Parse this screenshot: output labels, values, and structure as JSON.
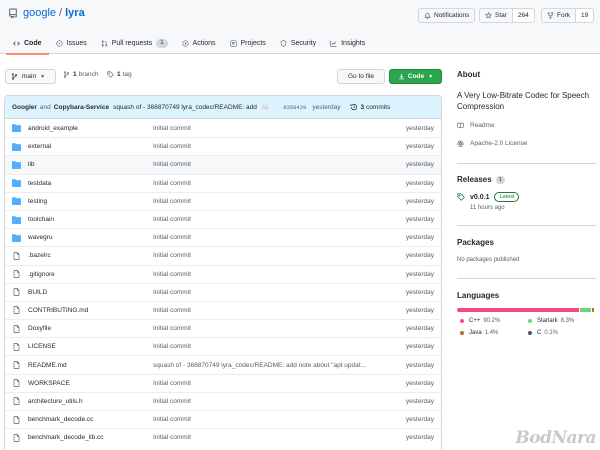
{
  "repo": {
    "owner": "google",
    "separator": "/",
    "name": "lyra"
  },
  "header_buttons": {
    "notifications": "Notifications",
    "star": "Star",
    "star_count": "264",
    "fork": "Fork",
    "fork_count": "19"
  },
  "tabs": [
    {
      "label": "Code",
      "icon": "code-icon"
    },
    {
      "label": "Issues",
      "icon": "issue-icon"
    },
    {
      "label": "Pull requests",
      "icon": "pull-request-icon",
      "badge": "1"
    },
    {
      "label": "Actions",
      "icon": "play-icon"
    },
    {
      "label": "Projects",
      "icon": "project-icon"
    },
    {
      "label": "Security",
      "icon": "shield-icon"
    },
    {
      "label": "Insights",
      "icon": "graph-icon"
    }
  ],
  "branch_bar": {
    "branch": "main",
    "branches_count": "1",
    "branches_label": "branch",
    "tags_count": "1",
    "tags_label": "tag",
    "goto_file": "Go to file",
    "code": "Code"
  },
  "commit": {
    "author1": "Googler",
    "and": "and",
    "author2": "Copybara-Service",
    "message": "squash of - 366870749 lyra_codec/README: add note a...",
    "ellipsis": "...",
    "sha": "9358429",
    "when": "yesterday",
    "commits_count": "3",
    "commits_label": "commits"
  },
  "files": [
    {
      "name": "android_example",
      "type": "folder",
      "message": "Initial commit",
      "date": "yesterday"
    },
    {
      "name": "external",
      "type": "folder",
      "message": "Initial commit",
      "date": "yesterday"
    },
    {
      "name": "lib",
      "type": "folder",
      "message": "Initial commit",
      "date": "yesterday"
    },
    {
      "name": "testdata",
      "type": "folder",
      "message": "Initial commit",
      "date": "yesterday"
    },
    {
      "name": "testing",
      "type": "folder",
      "message": "Initial commit",
      "date": "yesterday"
    },
    {
      "name": "toolchain",
      "type": "folder",
      "message": "Initial commit",
      "date": "yesterday"
    },
    {
      "name": "wavegru",
      "type": "folder",
      "message": "Initial commit",
      "date": "yesterday"
    },
    {
      "name": ".bazelrc",
      "type": "file",
      "message": "Initial commit",
      "date": "yesterday"
    },
    {
      "name": ".gitignore",
      "type": "file",
      "message": "Initial commit",
      "date": "yesterday"
    },
    {
      "name": "BUILD",
      "type": "file",
      "message": "Initial commit",
      "date": "yesterday"
    },
    {
      "name": "CONTRIBUTING.md",
      "type": "file",
      "message": "Initial commit",
      "date": "yesterday"
    },
    {
      "name": "Doxyfile",
      "type": "file",
      "message": "Initial commit",
      "date": "yesterday"
    },
    {
      "name": "LICENSE",
      "type": "file",
      "message": "Initial commit",
      "date": "yesterday"
    },
    {
      "name": "README.md",
      "type": "file",
      "message": "squash of - 366870749 lyra_codec/README: add note about \"apt updat...",
      "date": "yesterday"
    },
    {
      "name": "WORKSPACE",
      "type": "file",
      "message": "Initial commit",
      "date": "yesterday"
    },
    {
      "name": "architecture_utils.h",
      "type": "file",
      "message": "Initial commit",
      "date": "yesterday"
    },
    {
      "name": "benchmark_decode.cc",
      "type": "file",
      "message": "Initial commit",
      "date": "yesterday"
    },
    {
      "name": "benchmark_decode_lib.cc",
      "type": "file",
      "message": "Initial commit",
      "date": "yesterday"
    }
  ],
  "about": {
    "heading": "About",
    "description": "A Very Low-Bitrate Codec for Speech Compression",
    "readme": "Readme",
    "license": "Apache-2.0 License"
  },
  "releases": {
    "heading": "Releases",
    "count": "1",
    "name": "v0.0.1",
    "latest": "Latest",
    "time": "11 hours ago"
  },
  "packages": {
    "heading": "Packages",
    "empty": "No packages published"
  },
  "languages": {
    "heading": "Languages",
    "items": [
      {
        "name": "C++",
        "percent": "90.2%",
        "value": 90.2,
        "color": "#f34b7d"
      },
      {
        "name": "Starlark",
        "percent": "8.3%",
        "value": 8.3,
        "color": "#76d275"
      },
      {
        "name": "Java",
        "percent": "1.4%",
        "value": 1.4,
        "color": "#b07219"
      },
      {
        "name": "C",
        "percent": "0.1%",
        "value": 0.1,
        "color": "#555555"
      }
    ]
  },
  "watermark": "BodNara",
  "colors": {
    "accent": "#0969da",
    "primary_button": "#2da44e",
    "active_tab_underline": "#fd8c73",
    "folder": "#54aeff"
  }
}
